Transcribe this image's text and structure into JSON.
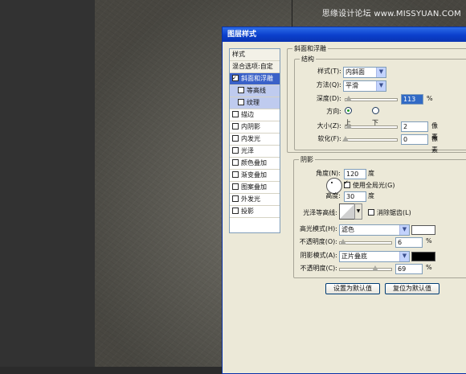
{
  "watermark": "思缘设计论坛 www.MISSYUAN.COM",
  "dialog": {
    "title": "图层样式",
    "style_list": [
      {
        "label": "样式",
        "kind": "header"
      },
      {
        "label": "混合选项:自定",
        "kind": "header"
      },
      {
        "label": "斜面和浮雕",
        "kind": "selected",
        "checked": true
      },
      {
        "label": "等高线",
        "kind": "sub",
        "checked": false
      },
      {
        "label": "纹理",
        "kind": "sub",
        "checked": false
      },
      {
        "label": "描边",
        "kind": "item",
        "checked": false
      },
      {
        "label": "内阴影",
        "kind": "item",
        "checked": false
      },
      {
        "label": "内发光",
        "kind": "item",
        "checked": false
      },
      {
        "label": "光泽",
        "kind": "item",
        "checked": false
      },
      {
        "label": "颜色叠加",
        "kind": "item",
        "checked": false
      },
      {
        "label": "渐变叠加",
        "kind": "item",
        "checked": false
      },
      {
        "label": "图案叠加",
        "kind": "item",
        "checked": false
      },
      {
        "label": "外发光",
        "kind": "item",
        "checked": false
      },
      {
        "label": "投影",
        "kind": "item",
        "checked": false
      }
    ],
    "bevel": {
      "section_title": "斜面和浮雕",
      "structure_title": "结构",
      "style_label": "样式(T):",
      "style_value": "内斜面",
      "technique_label": "方法(Q):",
      "technique_value": "平滑",
      "depth_label": "深度(D):",
      "depth_value": "113",
      "depth_unit": "%",
      "direction_label": "方向:",
      "direction_up": "上",
      "direction_down": "下",
      "size_label": "大小(Z):",
      "size_value": "2",
      "size_unit": "像素",
      "soften_label": "软化(F):",
      "soften_value": "0",
      "soften_unit": "像素"
    },
    "shading": {
      "title": "阴影",
      "angle_label": "角度(N):",
      "angle_value": "120",
      "angle_unit": "度",
      "global_light_label": "使用全局光(G)",
      "altitude_label": "高度:",
      "altitude_value": "30",
      "altitude_unit": "度",
      "gloss_contour_label": "光泽等高线:",
      "anti_alias_label": "消除锯齿(L)",
      "highlight_mode_label": "高光模式(H):",
      "highlight_mode_value": "滤色",
      "highlight_color": "#ffffff",
      "highlight_opacity_label": "不透明度(O):",
      "highlight_opacity_value": "6",
      "shadow_mode_label": "阴影模式(A):",
      "shadow_mode_value": "正片叠底",
      "shadow_color": "#000000",
      "shadow_opacity_label": "不透明度(C):",
      "shadow_opacity_value": "69",
      "percent": "%"
    },
    "buttons": {
      "make_default": "设置为默认值",
      "reset_default": "复位为默认值"
    }
  }
}
